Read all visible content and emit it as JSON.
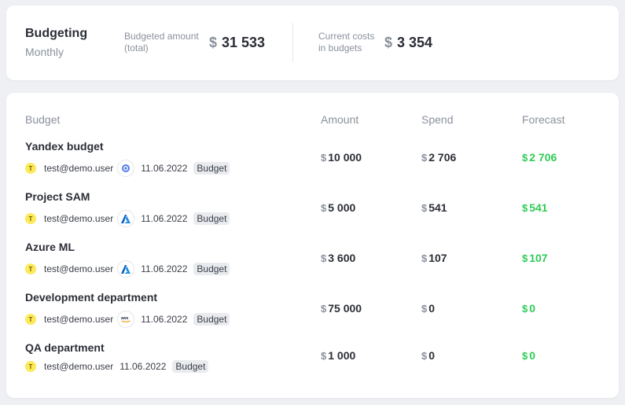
{
  "summary": {
    "title": "Budgeting",
    "subtitle": "Monthly",
    "budgeted_label_1": "Budgeted amount",
    "budgeted_label_2": "(total)",
    "budgeted_currency": "$",
    "budgeted_value": "31 533",
    "costs_label_1": "Current costs",
    "costs_label_2": "in budgets",
    "costs_currency": "$",
    "costs_value": "3 354"
  },
  "table": {
    "headers": {
      "budget": "Budget",
      "amount": "Amount",
      "spend": "Spend",
      "forecast": "Forecast"
    },
    "currency": "$",
    "rows": [
      {
        "name": "Yandex budget",
        "avatar": "T",
        "owner": "test@demo.user",
        "datasource_icon": "yandex-cloud-icon",
        "date": "11.06.2022",
        "tag": "Budget",
        "amount": "10 000",
        "spend": "2 706",
        "forecast": "2 706"
      },
      {
        "name": "Project SAM",
        "avatar": "T",
        "owner": "test@demo.user",
        "datasource_icon": "azure-icon",
        "date": "11.06.2022",
        "tag": "Budget",
        "amount": "5 000",
        "spend": "541",
        "forecast": "541"
      },
      {
        "name": "Azure ML",
        "avatar": "T",
        "owner": "test@demo.user",
        "datasource_icon": "azure-icon",
        "date": "11.06.2022",
        "tag": "Budget",
        "amount": "3 600",
        "spend": "107",
        "forecast": "107"
      },
      {
        "name": "Development department",
        "avatar": "T",
        "owner": "test@demo.user",
        "datasource_icon": "aws-icon",
        "date": "11.06.2022",
        "tag": "Budget",
        "amount": "75 000",
        "spend": "0",
        "forecast": "0"
      },
      {
        "name": "QA department",
        "avatar": "T",
        "owner": "test@demo.user",
        "date": "11.06.2022",
        "tag": "Budget",
        "amount": "1 000",
        "spend": "0",
        "forecast": "0"
      }
    ]
  },
  "colors": {
    "forecast": "#2ecc55",
    "avatar": "#fde95a",
    "background": "#eff0f4"
  }
}
